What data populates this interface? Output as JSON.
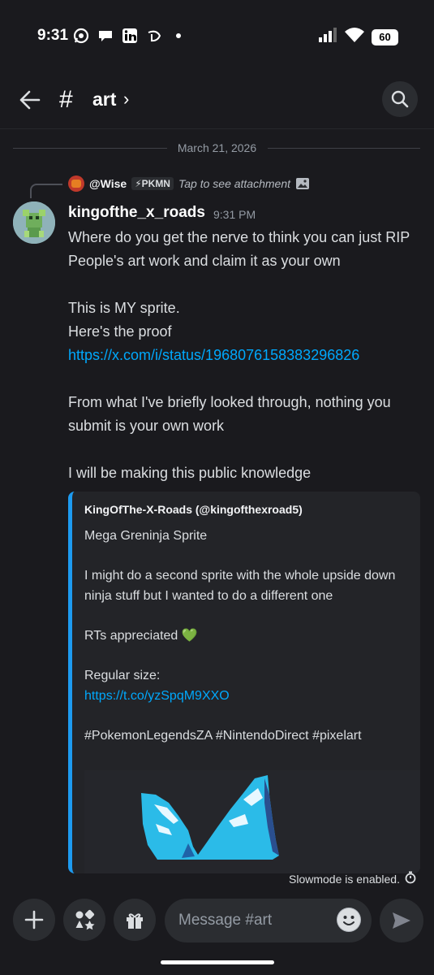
{
  "status_bar": {
    "time": "9:31",
    "battery": "60",
    "left_icons": [
      "whatsapp-icon",
      "chat-bubble-icon",
      "linkedin-icon",
      "disney-icon",
      "dot-icon"
    ],
    "right_icons": [
      "signal-icon",
      "wifi-icon",
      "battery-icon"
    ]
  },
  "header": {
    "channel_hash": "#",
    "channel_name": "art",
    "chevron": "›"
  },
  "date_separator": "March 21, 2026",
  "reply": {
    "user": "@Wise",
    "tag": "⚡PKMN",
    "text": "Tap to see attachment"
  },
  "message": {
    "author": "kingofthe_x_roads",
    "time": "9:31 PM",
    "para1": "Where do you get the nerve to think you can just RIP People's art work and claim it as your own",
    "para2_line1": "This is MY sprite.",
    "para2_line2": "Here's the proof",
    "link": "https://x.com/i/status/1968076158383296826",
    "para3": "From what I've briefly looked through, nothing you submit is your own work",
    "para4": "I will be making this public knowledge"
  },
  "embed": {
    "author": "KingOfThe-X-Roads (@kingofthexroad5)",
    "line1": "Mega Greninja Sprite",
    "line2": "I might do a second sprite with the whole upside down ninja stuff but I wanted to do a different one",
    "line3": "RTs appreciated",
    "heart": "💚",
    "line4": "Regular size:",
    "link": "https://t.co/yzSpqM9XXO",
    "hashtags": "#PokemonLegendsZA #NintendoDirect #pixelart"
  },
  "slowmode": "Slowmode is enabled.",
  "input": {
    "placeholder": "Message #art"
  },
  "colors": {
    "background": "#1a1a1e",
    "link": "#00a8fc",
    "embed_accent": "#1d9bf0"
  }
}
